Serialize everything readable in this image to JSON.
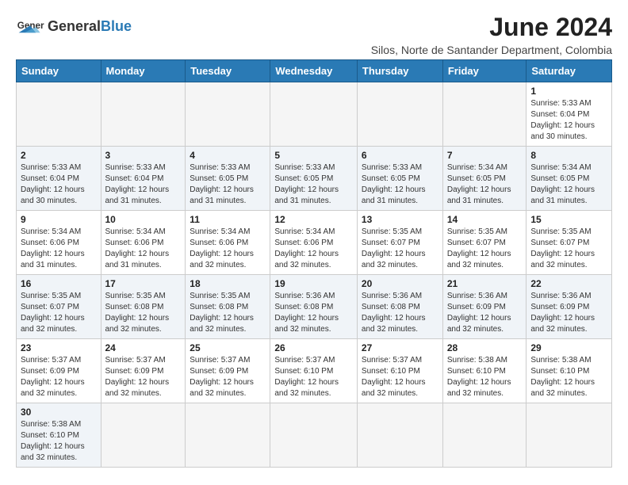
{
  "logo": {
    "text_general": "General",
    "text_blue": "Blue"
  },
  "title": "June 2024",
  "subtitle": "Silos, Norte de Santander Department, Colombia",
  "weekdays": [
    "Sunday",
    "Monday",
    "Tuesday",
    "Wednesday",
    "Thursday",
    "Friday",
    "Saturday"
  ],
  "weeks": [
    [
      {
        "day": "",
        "info": ""
      },
      {
        "day": "",
        "info": ""
      },
      {
        "day": "",
        "info": ""
      },
      {
        "day": "",
        "info": ""
      },
      {
        "day": "",
        "info": ""
      },
      {
        "day": "",
        "info": ""
      },
      {
        "day": "1",
        "info": "Sunrise: 5:33 AM\nSunset: 6:04 PM\nDaylight: 12 hours\nand 30 minutes."
      }
    ],
    [
      {
        "day": "2",
        "info": "Sunrise: 5:33 AM\nSunset: 6:04 PM\nDaylight: 12 hours\nand 30 minutes."
      },
      {
        "day": "3",
        "info": "Sunrise: 5:33 AM\nSunset: 6:04 PM\nDaylight: 12 hours\nand 31 minutes."
      },
      {
        "day": "4",
        "info": "Sunrise: 5:33 AM\nSunset: 6:05 PM\nDaylight: 12 hours\nand 31 minutes."
      },
      {
        "day": "5",
        "info": "Sunrise: 5:33 AM\nSunset: 6:05 PM\nDaylight: 12 hours\nand 31 minutes."
      },
      {
        "day": "6",
        "info": "Sunrise: 5:33 AM\nSunset: 6:05 PM\nDaylight: 12 hours\nand 31 minutes."
      },
      {
        "day": "7",
        "info": "Sunrise: 5:34 AM\nSunset: 6:05 PM\nDaylight: 12 hours\nand 31 minutes."
      },
      {
        "day": "8",
        "info": "Sunrise: 5:34 AM\nSunset: 6:05 PM\nDaylight: 12 hours\nand 31 minutes."
      }
    ],
    [
      {
        "day": "9",
        "info": "Sunrise: 5:34 AM\nSunset: 6:06 PM\nDaylight: 12 hours\nand 31 minutes."
      },
      {
        "day": "10",
        "info": "Sunrise: 5:34 AM\nSunset: 6:06 PM\nDaylight: 12 hours\nand 31 minutes."
      },
      {
        "day": "11",
        "info": "Sunrise: 5:34 AM\nSunset: 6:06 PM\nDaylight: 12 hours\nand 32 minutes."
      },
      {
        "day": "12",
        "info": "Sunrise: 5:34 AM\nSunset: 6:06 PM\nDaylight: 12 hours\nand 32 minutes."
      },
      {
        "day": "13",
        "info": "Sunrise: 5:35 AM\nSunset: 6:07 PM\nDaylight: 12 hours\nand 32 minutes."
      },
      {
        "day": "14",
        "info": "Sunrise: 5:35 AM\nSunset: 6:07 PM\nDaylight: 12 hours\nand 32 minutes."
      },
      {
        "day": "15",
        "info": "Sunrise: 5:35 AM\nSunset: 6:07 PM\nDaylight: 12 hours\nand 32 minutes."
      }
    ],
    [
      {
        "day": "16",
        "info": "Sunrise: 5:35 AM\nSunset: 6:07 PM\nDaylight: 12 hours\nand 32 minutes."
      },
      {
        "day": "17",
        "info": "Sunrise: 5:35 AM\nSunset: 6:08 PM\nDaylight: 12 hours\nand 32 minutes."
      },
      {
        "day": "18",
        "info": "Sunrise: 5:35 AM\nSunset: 6:08 PM\nDaylight: 12 hours\nand 32 minutes."
      },
      {
        "day": "19",
        "info": "Sunrise: 5:36 AM\nSunset: 6:08 PM\nDaylight: 12 hours\nand 32 minutes."
      },
      {
        "day": "20",
        "info": "Sunrise: 5:36 AM\nSunset: 6:08 PM\nDaylight: 12 hours\nand 32 minutes."
      },
      {
        "day": "21",
        "info": "Sunrise: 5:36 AM\nSunset: 6:09 PM\nDaylight: 12 hours\nand 32 minutes."
      },
      {
        "day": "22",
        "info": "Sunrise: 5:36 AM\nSunset: 6:09 PM\nDaylight: 12 hours\nand 32 minutes."
      }
    ],
    [
      {
        "day": "23",
        "info": "Sunrise: 5:37 AM\nSunset: 6:09 PM\nDaylight: 12 hours\nand 32 minutes."
      },
      {
        "day": "24",
        "info": "Sunrise: 5:37 AM\nSunset: 6:09 PM\nDaylight: 12 hours\nand 32 minutes."
      },
      {
        "day": "25",
        "info": "Sunrise: 5:37 AM\nSunset: 6:09 PM\nDaylight: 12 hours\nand 32 minutes."
      },
      {
        "day": "26",
        "info": "Sunrise: 5:37 AM\nSunset: 6:10 PM\nDaylight: 12 hours\nand 32 minutes."
      },
      {
        "day": "27",
        "info": "Sunrise: 5:37 AM\nSunset: 6:10 PM\nDaylight: 12 hours\nand 32 minutes."
      },
      {
        "day": "28",
        "info": "Sunrise: 5:38 AM\nSunset: 6:10 PM\nDaylight: 12 hours\nand 32 minutes."
      },
      {
        "day": "29",
        "info": "Sunrise: 5:38 AM\nSunset: 6:10 PM\nDaylight: 12 hours\nand 32 minutes."
      }
    ],
    [
      {
        "day": "30",
        "info": "Sunrise: 5:38 AM\nSunset: 6:10 PM\nDaylight: 12 hours\nand 32 minutes."
      },
      {
        "day": "",
        "info": ""
      },
      {
        "day": "",
        "info": ""
      },
      {
        "day": "",
        "info": ""
      },
      {
        "day": "",
        "info": ""
      },
      {
        "day": "",
        "info": ""
      },
      {
        "day": "",
        "info": ""
      }
    ]
  ]
}
